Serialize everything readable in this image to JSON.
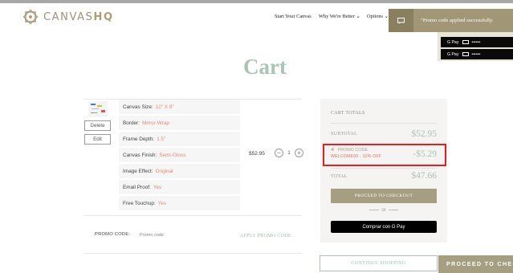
{
  "brand": {
    "name_part1": "CANVAS",
    "name_part2": "HQ"
  },
  "nav": {
    "items": [
      "Start Your Canvas",
      "Why We're Better ⌄",
      "Options ⌄"
    ]
  },
  "toast": {
    "message": "\"Promo code applied successfully."
  },
  "express_pay": {
    "label": "G Pay",
    "masked": "••••••"
  },
  "page": {
    "title": "Cart"
  },
  "product": {
    "delete_label": "Delete",
    "edit_label": "Edit",
    "options": [
      {
        "label": "Canvas Size:",
        "value": "12\" X 8\""
      },
      {
        "label": "Border:",
        "value": "Mirror-Wrap"
      },
      {
        "label": "Frame Depth:",
        "value": "1.5\""
      },
      {
        "label": "Canvas Finish:",
        "value": "Semi-Gloss"
      },
      {
        "label": "Image Effect:",
        "value": "Original"
      },
      {
        "label": "Email Proof:",
        "value": "Yes"
      },
      {
        "label": "Free Touchup:",
        "value": "Yes"
      }
    ],
    "price": "$52.95",
    "quantity": "1",
    "minus": "−",
    "plus": "+"
  },
  "promo": {
    "label": "PROMO CODE:",
    "placeholder": "Promo code",
    "apply": "APPLY PROMO CODE"
  },
  "totals": {
    "heading": "CART TOTALS",
    "subtotal_label": "SUBTOTAL",
    "subtotal_value": "$52.95",
    "discount_remove": "✕",
    "discount_label": "PROMO CODE",
    "discount_code": "WELCOME60 - 10% OFF",
    "discount_value": "-$5.29",
    "total_label": "TOTAL",
    "total_value": "$47.66",
    "checkout_label": "PROCEED TO CHECKOUT",
    "or_label": "or",
    "gpay_label": "Comprar con G Pay"
  },
  "footer_actions": {
    "continue_label": "CONTINUE SHOPPING",
    "sticky_checkout": "PROCEED TO CHECK"
  },
  "colors": {
    "accent_green": "#a9c4b4",
    "accent_gold": "#a69e80",
    "highlight_red": "#e02020"
  }
}
